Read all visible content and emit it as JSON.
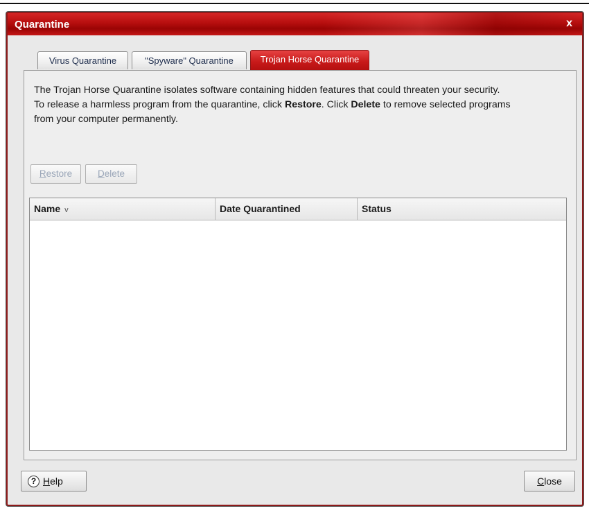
{
  "window": {
    "title": "Quarantine",
    "close_glyph": "x"
  },
  "tabs": [
    {
      "label": "Virus Quarantine",
      "active": false
    },
    {
      "label": "\"Spyware\" Quarantine",
      "active": false
    },
    {
      "label": "Trojan Horse Quarantine",
      "active": true
    }
  ],
  "description": {
    "line1": "The Trojan Horse Quarantine isolates software containing hidden features that could threaten your security.",
    "line2_pre": "To release a harmless program from the quarantine, click ",
    "restore_word": "Restore",
    "line2_mid": ". Click ",
    "delete_word": "Delete",
    "line2_post": " to remove selected programs",
    "line3": "from your computer permanently."
  },
  "actions": {
    "restore_first": "R",
    "restore_rest": "estore",
    "delete_first": "D",
    "delete_rest": "elete"
  },
  "table": {
    "columns": [
      {
        "label": "Name",
        "sort": "descending"
      },
      {
        "label": "Date Quarantined"
      },
      {
        "label": "Status"
      }
    ],
    "sort_indicator": "v",
    "rows": []
  },
  "footer": {
    "help_icon_glyph": "?",
    "help_first": "H",
    "help_rest": "elp",
    "close_first": "C",
    "close_rest": "lose"
  },
  "colors": {
    "titlebar": "#b60e0e",
    "active_tab": "#c81a1a",
    "disabled_text": "#9aa6b8"
  }
}
